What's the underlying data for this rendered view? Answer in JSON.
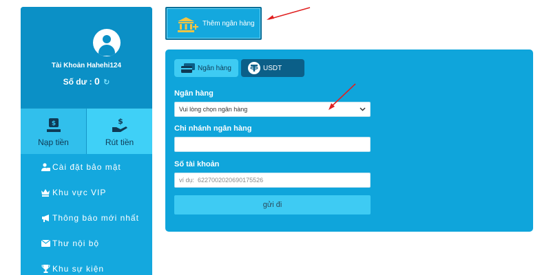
{
  "account": {
    "name": "Tài Khoản Hahehi124",
    "balance_label": "Số dư :",
    "balance_value": "0"
  },
  "actions": {
    "deposit_label": "Nạp tiền",
    "withdraw_label": "Rút tiền"
  },
  "menu": [
    {
      "label": "Cài đặt bảo mật",
      "icon": "user-lock-icon"
    },
    {
      "label": "Khu vực VIP",
      "icon": "crown-icon"
    },
    {
      "label": "Thông báo mới nhất",
      "icon": "megaphone-icon"
    },
    {
      "label": "Thư nội bộ",
      "icon": "envelope-icon"
    },
    {
      "label": "Khu sự kiện",
      "icon": "trophy-icon"
    }
  ],
  "add_bank": {
    "label": "Thêm ngân hàng",
    "icon": "bank-add-icon"
  },
  "tabs": [
    {
      "label": "Ngân hàng",
      "icon": "cards-icon"
    },
    {
      "label": "USDT",
      "icon": "tether-icon"
    }
  ],
  "form": {
    "bank_label": "Ngân hàng",
    "bank_select_value": "Vui lòng chọn ngân hàng",
    "branch_label": "Chi nhánh ngân hàng",
    "branch_value": "",
    "account_label": "Số tài khoản",
    "account_placeholder": "ví dụ:  6227002020690175526",
    "submit_label": "gửi đi"
  },
  "colors": {
    "primary": "#14a8de",
    "card": "#0fa5db",
    "accent_light": "#3ecbf3",
    "dark": "#0b5f88",
    "arrow": "#e02020"
  }
}
